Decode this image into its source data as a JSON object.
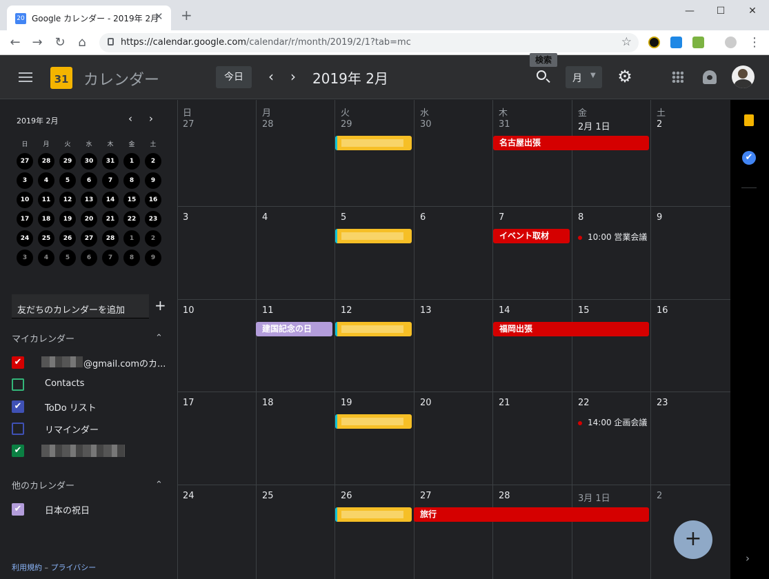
{
  "browser": {
    "tab_title": "Google カレンダー - 2019年 2月",
    "favicon_text": "20",
    "close_glyph": "✕",
    "new_tab_glyph": "+",
    "url_host": "https://calendar.google.com",
    "url_path": "/calendar/r/month/2019/2/1?tab=mc",
    "window_buttons": [
      "—",
      "☐",
      "✕"
    ]
  },
  "header": {
    "logo_text": "31",
    "title": "カレンダー",
    "today_label": "今日",
    "prev_glyph": "‹",
    "next_glyph": "›",
    "date_label": "2019年 2月",
    "search_tooltip": "検索",
    "view_label": "月",
    "view_caret": "▼",
    "gear_glyph": "⚙"
  },
  "mini_calendar": {
    "month_label": "2019年 2月",
    "weekdays": [
      "日",
      "月",
      "火",
      "水",
      "木",
      "金",
      "土"
    ],
    "days": [
      [
        "27",
        "28",
        "29",
        "30",
        "31",
        "1",
        "2"
      ],
      [
        "3",
        "4",
        "5",
        "6",
        "7",
        "8",
        "9"
      ],
      [
        "10",
        "11",
        "12",
        "13",
        "14",
        "15",
        "16"
      ],
      [
        "17",
        "18",
        "19",
        "20",
        "21",
        "22",
        "23"
      ],
      [
        "24",
        "25",
        "26",
        "27",
        "28",
        "1",
        "2"
      ],
      [
        "3",
        "4",
        "5",
        "6",
        "7",
        "8",
        "9"
      ]
    ]
  },
  "sidebar": {
    "add_friend_placeholder": "友だちのカレンダーを追加",
    "add_glyph": "+",
    "my_calendars_title": "マイカレンダー",
    "other_calendars_title": "他のカレンダー",
    "collapse_glyph": "⌃",
    "my_calendars": [
      {
        "label": "@gmail.comのカ...",
        "color": "#d50000",
        "checked": true
      },
      {
        "label": "Contacts",
        "color": "#33b679",
        "checked": false
      },
      {
        "label": "ToDo リスト",
        "color": "#3f51b5",
        "checked": true
      },
      {
        "label": "リマインダー",
        "color": "#3f51b5",
        "checked": false
      },
      {
        "label": "",
        "color": "#0b8043",
        "checked": true
      }
    ],
    "other_calendars": [
      {
        "label": "日本の祝日",
        "color": "#b39ddb",
        "checked": true
      }
    ],
    "footer_terms": "利用規約",
    "footer_sep": " – ",
    "footer_privacy": "プライバシー"
  },
  "grid": {
    "weekdays": [
      "日",
      "月",
      "火",
      "水",
      "木",
      "金",
      "土"
    ],
    "weeks": [
      [
        "27",
        "28",
        "29",
        "30",
        "31",
        "2月 1日",
        "2"
      ],
      [
        "3",
        "4",
        "5",
        "6",
        "7",
        "8",
        "9"
      ],
      [
        "10",
        "11",
        "12",
        "13",
        "14",
        "15",
        "16"
      ],
      [
        "17",
        "18",
        "19",
        "20",
        "21",
        "22",
        "23"
      ],
      [
        "24",
        "25",
        "26",
        "27",
        "28",
        "3月 1日",
        "2"
      ]
    ],
    "events": {
      "nagoya": "名古屋出張",
      "event_coverage": "イベント取材",
      "meeting1": "10:00 営業会議",
      "holiday": "建国記念の日",
      "fukuoka": "福岡出張",
      "meeting2": "14:00 企画会議",
      "trip": "旅行"
    }
  },
  "fab_glyph": "+",
  "right_panel": {
    "tasks_glyph": "✔",
    "expand_glyph": "›"
  }
}
